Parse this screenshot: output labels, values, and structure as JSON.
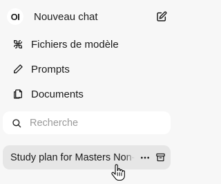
{
  "header": {
    "logo_text": "OI",
    "new_chat_label": "Nouveau chat"
  },
  "nav": {
    "items": [
      {
        "label": "Fichiers de modèle",
        "icon": "grid-icon"
      },
      {
        "label": "Prompts",
        "icon": "pencil-icon"
      },
      {
        "label": "Documents",
        "icon": "documents-icon"
      }
    ]
  },
  "search": {
    "placeholder": "Recherche"
  },
  "chats": [
    {
      "title": "Study plan for Masters Non-Native"
    }
  ],
  "colors": {
    "background": "#f7f7f7",
    "search_bg": "#ffffff",
    "selected_chat_bg": "#e6e6e6"
  }
}
